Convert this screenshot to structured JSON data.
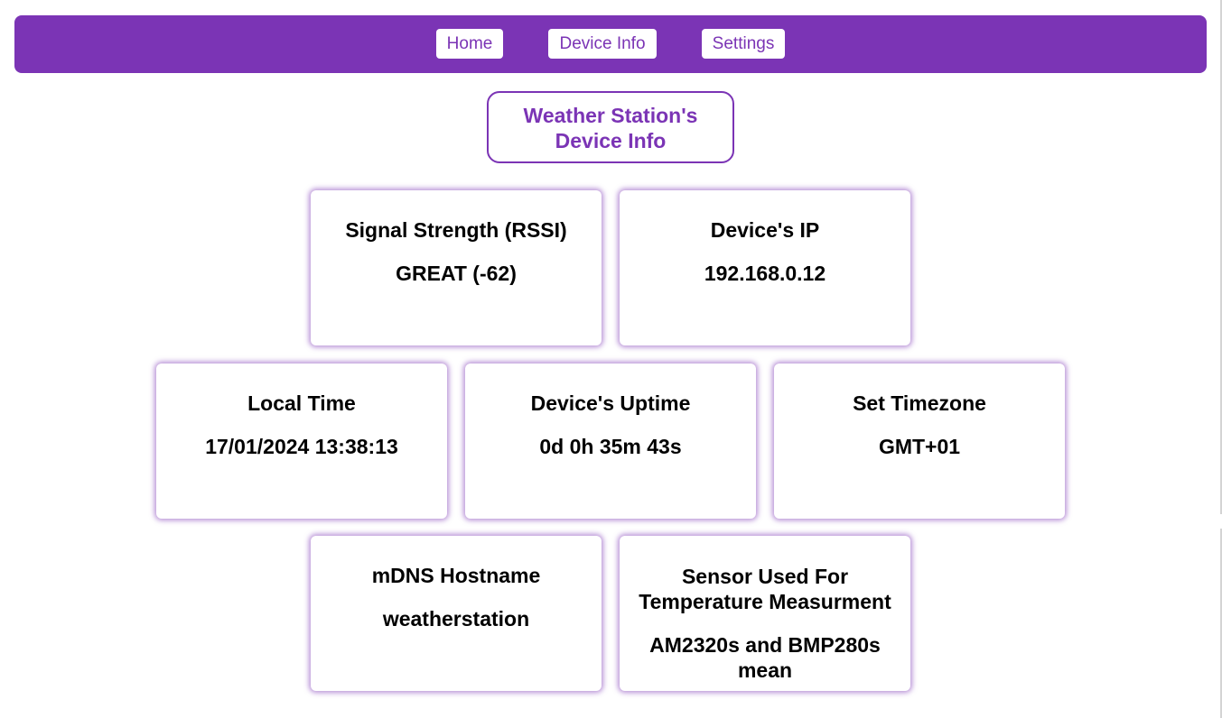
{
  "nav": {
    "home": "Home",
    "device_info": "Device Info",
    "settings": "Settings"
  },
  "header": {
    "title_line1": "Weather Station's",
    "title_line2": "Device Info"
  },
  "cards": [
    {
      "label": "Signal Strength (RSSI)",
      "value": "GREAT (-62)"
    },
    {
      "label": "Device's IP",
      "value": "192.168.0.12"
    },
    {
      "label": "Local Time",
      "value": "17/01/2024 13:38:13"
    },
    {
      "label": "Device's Uptime",
      "value": "0d 0h 35m 43s"
    },
    {
      "label": "Set Timezone",
      "value": "GMT+01"
    },
    {
      "label": "mDNS Hostname",
      "value": "weatherstation"
    },
    {
      "label": "Sensor Used For Temperature Measurment",
      "value": "AM2320s and BMP280s mean"
    }
  ],
  "colors": {
    "accent": "#7b34b5",
    "background": "#ffffff"
  }
}
